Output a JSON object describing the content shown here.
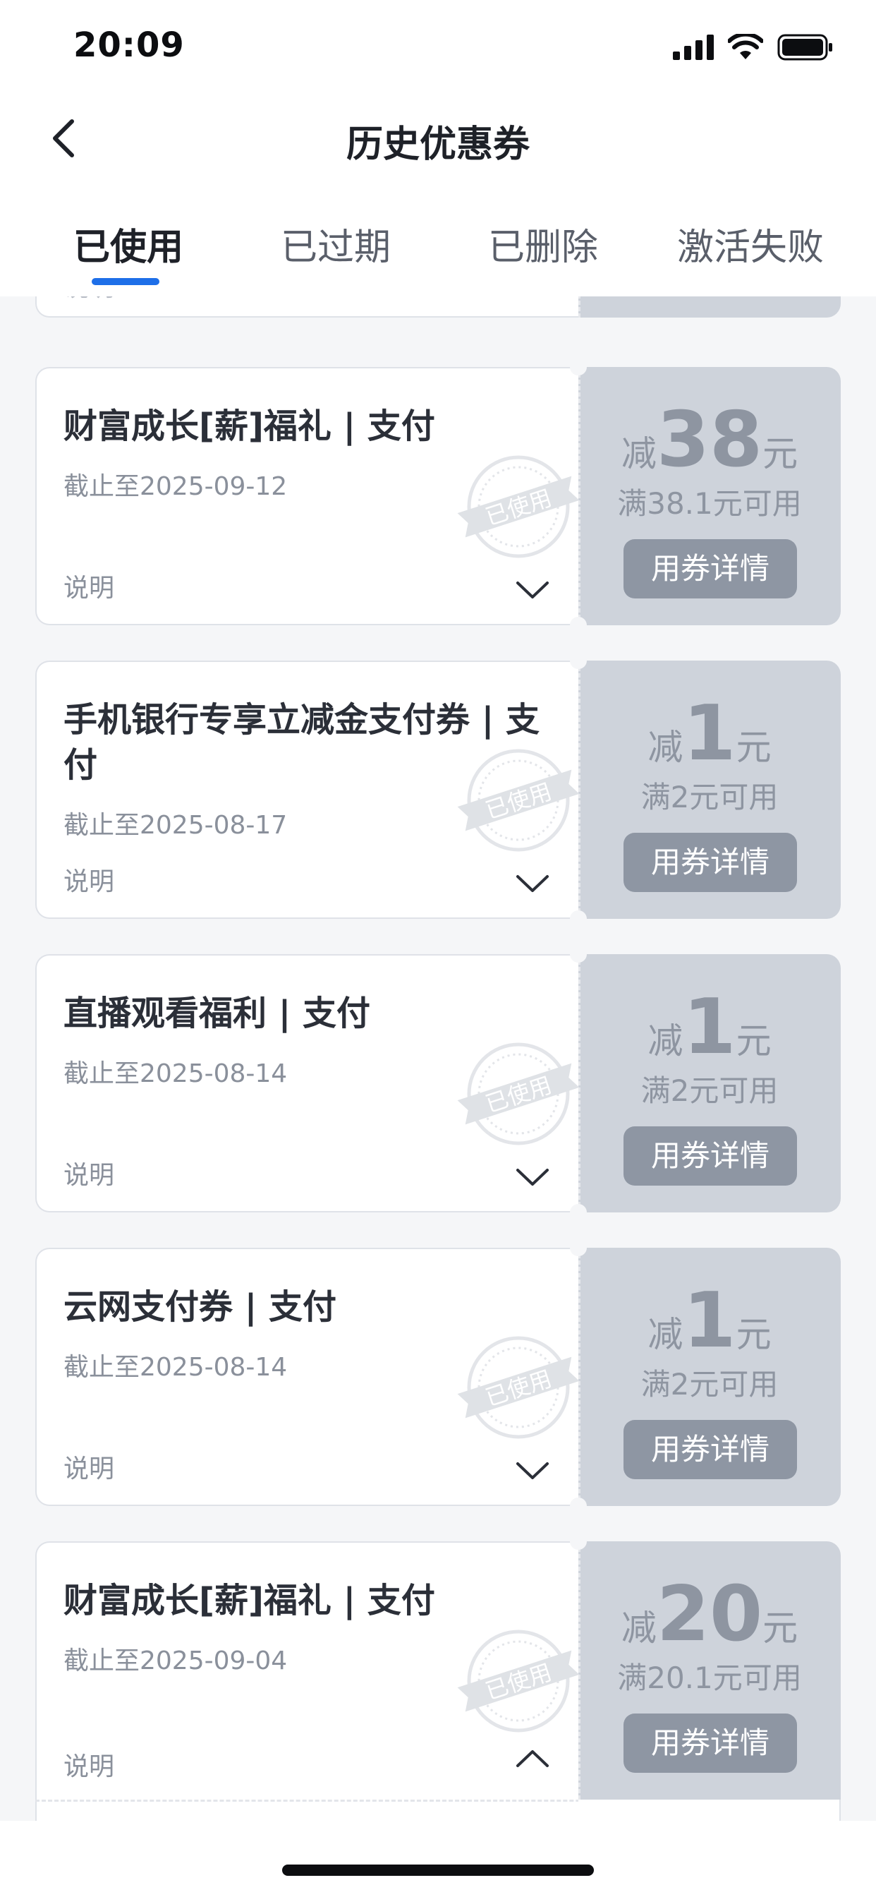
{
  "status_bar": {
    "time": "20:09"
  },
  "nav": {
    "title": "历史优惠券"
  },
  "tabs": [
    {
      "label": "已使用",
      "active": true
    },
    {
      "label": "已过期",
      "active": false
    },
    {
      "label": "已删除",
      "active": false
    },
    {
      "label": "激活失败",
      "active": false
    }
  ],
  "partial_coupon": {
    "desc_label": "说明"
  },
  "coupons": [
    {
      "title": "财富成长[薪]福礼 | 支付",
      "date": "截止至2025-09-12",
      "desc_label": "说明",
      "stamp": "已使用",
      "amount_prefix": "减",
      "amount": "38",
      "amount_suffix": "元",
      "condition": "满38.1元可用",
      "button": "用券详情",
      "expanded": false
    },
    {
      "title": "手机银行专享立减金支付券 | 支付",
      "date": "截止至2025-08-17",
      "desc_label": "说明",
      "stamp": "已使用",
      "amount_prefix": "减",
      "amount": "1",
      "amount_suffix": "元",
      "condition": "满2元可用",
      "button": "用券详情",
      "expanded": false
    },
    {
      "title": "直播观看福利 | 支付",
      "date": "截止至2025-08-14",
      "desc_label": "说明",
      "stamp": "已使用",
      "amount_prefix": "减",
      "amount": "1",
      "amount_suffix": "元",
      "condition": "满2元可用",
      "button": "用券详情",
      "expanded": false
    },
    {
      "title": "云网支付券 | 支付",
      "date": "截止至2025-08-14",
      "desc_label": "说明",
      "stamp": "已使用",
      "amount_prefix": "减",
      "amount": "1",
      "amount_suffix": "元",
      "condition": "满2元可用",
      "button": "用券详情",
      "expanded": false
    },
    {
      "title": "财富成长[薪]福礼 | 支付",
      "date": "截止至2025-09-04",
      "desc_label": "说明",
      "stamp": "已使用",
      "amount_prefix": "减",
      "amount": "20",
      "amount_suffix": "元",
      "condition": "满20.1元可用",
      "button": "用券详情",
      "expanded": true
    }
  ],
  "colors": {
    "accent": "#1e6fe8",
    "coupon_right": "#ced3db",
    "button": "#8e96a3"
  }
}
